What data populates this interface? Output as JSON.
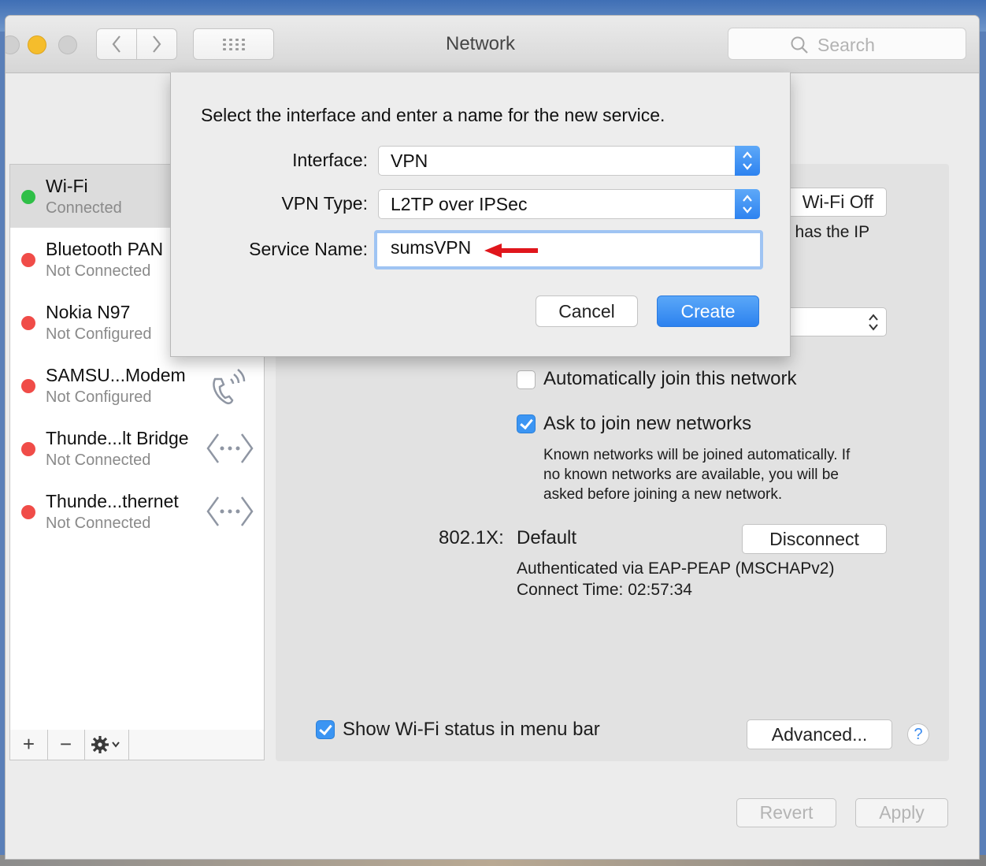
{
  "window": {
    "title": "Network",
    "search_placeholder": "Search"
  },
  "services": [
    {
      "name": "Wi-Fi",
      "status": "Connected",
      "color": "#2fbf47"
    },
    {
      "name": "Bluetooth PAN",
      "status": "Not Connected",
      "color": "#f04c48"
    },
    {
      "name": "Nokia N97",
      "status": "Not Configured",
      "color": "#f04c48"
    },
    {
      "name": "SAMSU...Modem",
      "status": "Not Configured",
      "color": "#f04c48"
    },
    {
      "name": "Thunde...lt Bridge",
      "status": "Not Connected",
      "color": "#f04c48"
    },
    {
      "name": "Thunde...thernet",
      "status": "Not Connected",
      "color": "#f04c48"
    }
  ],
  "sidebar_tools": {
    "add": "+",
    "remove": "−"
  },
  "wifi_panel": {
    "wifi_off_button": "Wi-Fi Off",
    "status_fragment": "d has the IP",
    "auto_join_label": "Automatically join this network",
    "auto_join_checked": false,
    "ask_join_label": "Ask to join new networks",
    "ask_join_checked": true,
    "ask_join_help": [
      "Known networks will be joined automatically. If",
      "no known networks are available, you will be",
      "asked before joining a new network."
    ],
    "dot1x_label": "802.1X:",
    "dot1x_value": "Default",
    "disconnect_button": "Disconnect",
    "auth_info": "Authenticated via EAP-PEAP (MSCHAPv2)",
    "connect_time": "Connect Time: 02:57:34",
    "show_status_label": "Show Wi-Fi status in menu bar",
    "show_status_checked": true,
    "advanced_button": "Advanced...",
    "help_button": "?"
  },
  "footer": {
    "revert": "Revert",
    "apply": "Apply"
  },
  "sheet": {
    "prompt": "Select the interface and enter a name for the new service.",
    "interface_label": "Interface:",
    "interface_value": "VPN",
    "vpn_type_label": "VPN Type:",
    "vpn_type_value": "L2TP over IPSec",
    "service_name_label": "Service Name:",
    "service_name_value": "sumsVPN",
    "cancel_button": "Cancel",
    "create_button": "Create"
  },
  "colors": {
    "accent": "#3b95f3",
    "annotation_arrow": "#e0161c"
  }
}
